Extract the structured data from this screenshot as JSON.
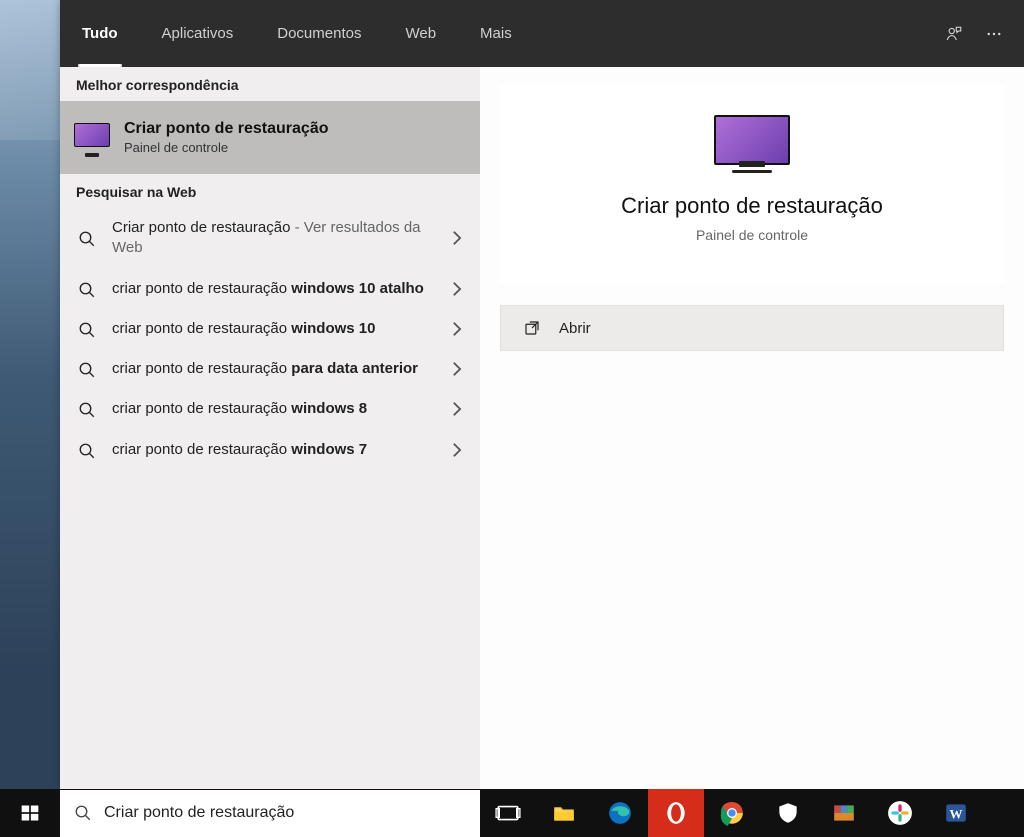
{
  "tabs": {
    "all": "Tudo",
    "apps": "Aplicativos",
    "docs": "Documentos",
    "web": "Web",
    "more": "Mais"
  },
  "sections": {
    "best": "Melhor correspondência",
    "web": "Pesquisar na Web"
  },
  "best_match": {
    "title": "Criar ponto de restauração",
    "subtitle": "Painel de controle"
  },
  "web_results": [
    {
      "prefix": "Criar ponto de restauração",
      "suffix": "",
      "light": " - Ver resultados da Web"
    },
    {
      "prefix": "criar ponto de restauração ",
      "suffix": "windows 10 atalho",
      "light": ""
    },
    {
      "prefix": "criar ponto de restauração ",
      "suffix": "windows 10",
      "light": ""
    },
    {
      "prefix": "criar ponto de restauração ",
      "suffix": "para data anterior",
      "light": ""
    },
    {
      "prefix": "criar ponto de restauração ",
      "suffix": "windows 8",
      "light": ""
    },
    {
      "prefix": "criar ponto de restauração ",
      "suffix": "windows 7",
      "light": ""
    }
  ],
  "detail": {
    "title": "Criar ponto de restauração",
    "subtitle": "Painel de controle",
    "action": "Abrir"
  },
  "searchbox": {
    "value": "Criar ponto de restauração"
  }
}
